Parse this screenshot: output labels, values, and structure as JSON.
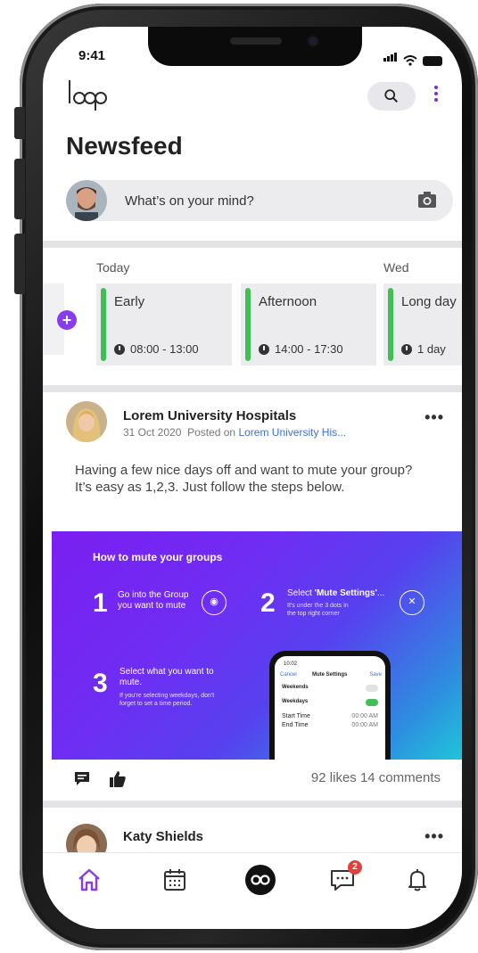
{
  "status_bar": {
    "time": "9:41"
  },
  "header": {
    "logo_text": "loop",
    "title": "Newsfeed"
  },
  "composer": {
    "placeholder": "What’s on your mind?"
  },
  "schedule": {
    "days": [
      "Today",
      "Wed"
    ],
    "shifts": [
      {
        "name": "Early",
        "time": "08:00 - 13:00"
      },
      {
        "name": "Afternoon",
        "time": "14:00 - 17:30"
      },
      {
        "name": "Long day",
        "time": "1 day"
      }
    ],
    "accent": "#3fbf55"
  },
  "post": {
    "author": "Lorem University Hospitals",
    "date": "31 Oct 2020",
    "posted_on_label": "Posted on",
    "posted_on_target": "Lorem University His...",
    "more": "•••",
    "text": "Having a few nice days off and want to mute your group? It’s easy as 1,2,3. Just follow the steps below.",
    "image": {
      "title": "How to mute your groups",
      "steps": [
        {
          "num": "1",
          "text": "Go into the Group you want to mute",
          "sub": ""
        },
        {
          "num": "2",
          "text_prefix": "Select ",
          "text_bold": "'Mute Settings'",
          "text_suffix": "...",
          "sub": "It's under the 3 dots in the top right corner"
        },
        {
          "num": "3",
          "text": "Select what you want to mute.",
          "sub": "If you're selecting weekdays, don't forget to set a time period."
        }
      ],
      "mini_phone": {
        "time": "10:02",
        "cancel": "Cancel",
        "heading": "Mute Settings",
        "save": "Save",
        "rows": [
          "Weekends",
          "Weekdays"
        ],
        "start_label": "Start Time",
        "start_value": "00:00 AM",
        "end_label": "End Time",
        "end_value": "00:00 AM"
      }
    },
    "likes": "92 likes",
    "comments": "14 comments"
  },
  "post2": {
    "author": "Katy Shields",
    "more": "•••"
  },
  "nav": {
    "messages_badge": "2",
    "active": "home",
    "accent": "#8a3ce8"
  },
  "icons": [
    "search-icon",
    "more-vertical-icon",
    "camera-icon",
    "add-icon",
    "clock-icon",
    "comment-icon",
    "like-icon",
    "home-icon",
    "calendar-icon",
    "loop-icon",
    "chat-icon",
    "bell-icon"
  ]
}
